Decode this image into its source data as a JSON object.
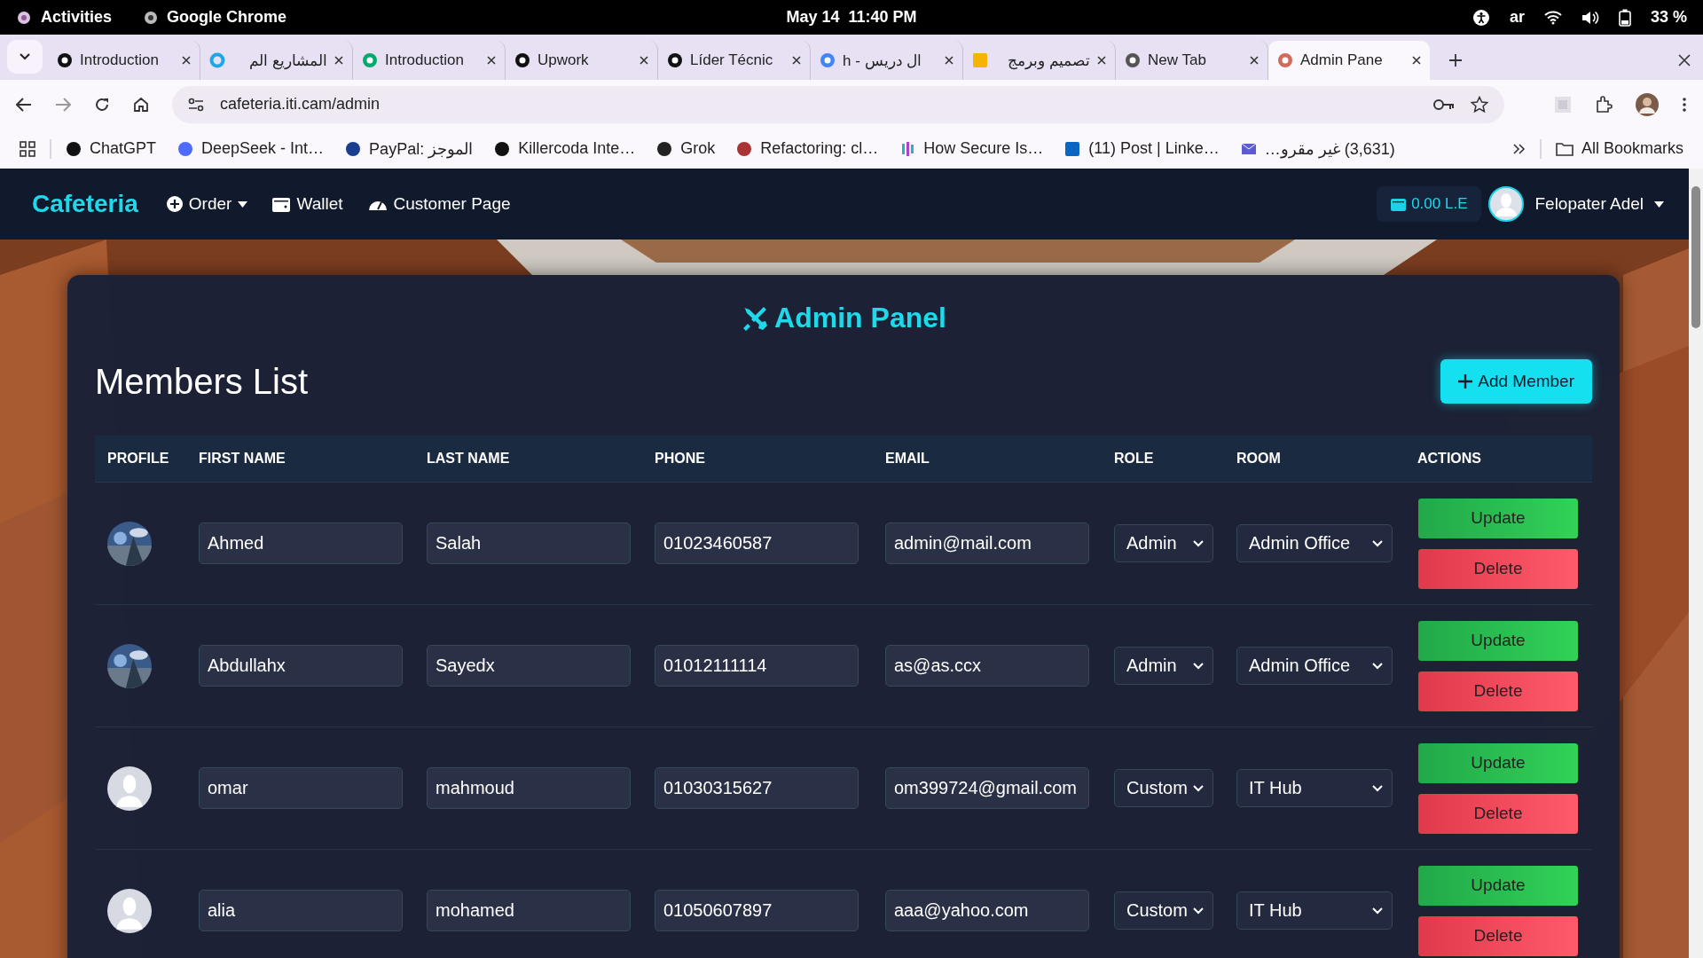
{
  "system_bar": {
    "activities": "Activities",
    "app": "Google Chrome",
    "clock": "May 14  11:40 PM",
    "language": "ar",
    "battery": "33 %"
  },
  "tabs": [
    {
      "title": "Introduction",
      "selected": false
    },
    {
      "title": "المشاريع الم",
      "selected": false
    },
    {
      "title": "Introduction",
      "selected": false
    },
    {
      "title": "Upwork",
      "selected": false
    },
    {
      "title": "Líder Técnic",
      "selected": false
    },
    {
      "title": "h - ال دريس",
      "selected": false
    },
    {
      "title": "تصميم وبرمج",
      "selected": false
    },
    {
      "title": "New Tab",
      "selected": false
    },
    {
      "title": "Admin Pane",
      "selected": true
    }
  ],
  "address_bar": {
    "url": "cafeteria.iti.cam/admin"
  },
  "bookmarks": [
    "ChatGPT",
    "DeepSeek - Int…",
    "PayPal: الموجز",
    "Killercoda Inte…",
    "Grok",
    "Refactoring: cl…",
    "How Secure Is…",
    "(11) Post | Linke…",
    "(3,631) غير مقرو…"
  ],
  "all_bookmarks": "All Bookmarks",
  "navbar": {
    "brand": "Cafeteria",
    "links": [
      {
        "label": "Order",
        "dropdown": true
      },
      {
        "label": "Wallet",
        "dropdown": false
      },
      {
        "label": "Customer Page",
        "dropdown": false
      }
    ],
    "balance": "0.00 L.E",
    "user": "Felopater Adel"
  },
  "panel": {
    "title": "Admin Panel",
    "heading": "Members List",
    "add_button": "Add Member",
    "columns": [
      "PROFILE",
      "FIRST NAME",
      "LAST NAME",
      "PHONE",
      "EMAIL",
      "ROLE",
      "ROOM",
      "ACTIONS"
    ],
    "rows": [
      {
        "first_name": "Ahmed",
        "last_name": "Salah",
        "phone": "01023460587",
        "email": "admin@mail.com",
        "role": "Admin",
        "room": "Admin Office",
        "update": "Update",
        "delete": "Delete"
      },
      {
        "first_name": "Abdullahx",
        "last_name": "Sayedx",
        "phone": "01012111114",
        "email": "as@as.ccx",
        "role": "Admin",
        "room": "Admin Office",
        "update": "Update",
        "delete": "Delete"
      },
      {
        "kind": "default",
        "first_name": "omar",
        "last_name": "mahmoud",
        "phone": "01030315627",
        "email": "om399724@gmail.com",
        "role": "Custom",
        "room": "IT Hub",
        "update": "Update",
        "delete": "Delete"
      },
      {
        "kind": "default",
        "first_name": "alia",
        "last_name": "mohamed",
        "phone": "01050607897",
        "email": "aaa@yahoo.com",
        "role": "Custom",
        "room": "IT Hub",
        "update": "Update",
        "delete": "Delete"
      }
    ]
  }
}
